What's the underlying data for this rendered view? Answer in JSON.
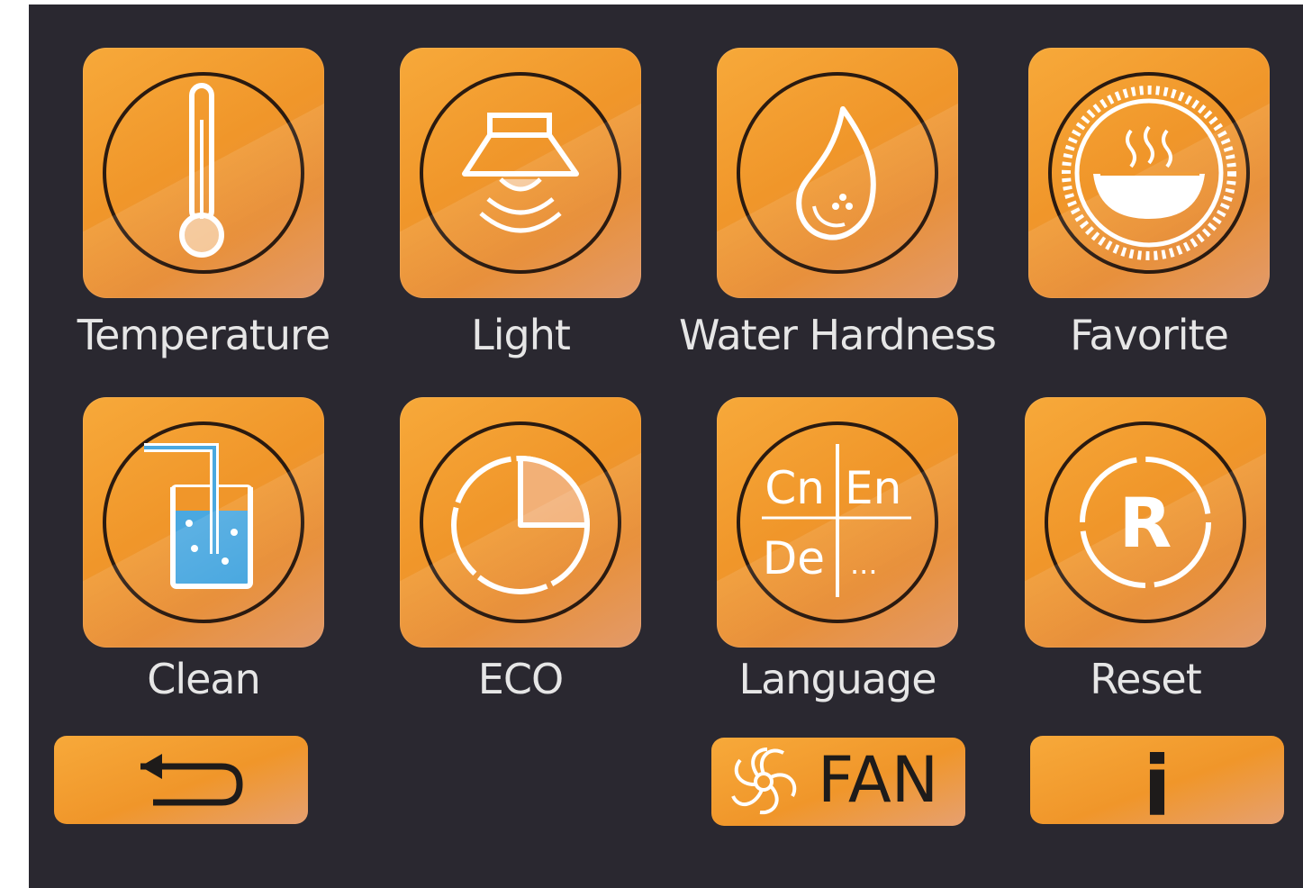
{
  "tiles": [
    {
      "label": "Temperature",
      "icon": "thermometer-icon"
    },
    {
      "label": "Light",
      "icon": "hood-light-icon"
    },
    {
      "label": "Water Hardness",
      "icon": "water-drop-icon"
    },
    {
      "label": "Favorite",
      "icon": "favorite-dish-icon"
    },
    {
      "label": "Clean",
      "icon": "clean-beaker-icon"
    },
    {
      "label": "ECO",
      "icon": "eco-timer-icon"
    },
    {
      "label": "Language",
      "icon": "language-icon"
    },
    {
      "label": "Reset",
      "icon": "reset-icon"
    }
  ],
  "language_icon": {
    "cn": "Cn",
    "en": "En",
    "de": "De",
    "more": "..."
  },
  "reset_icon": {
    "letter": "R"
  },
  "bottom": {
    "back_icon": "back-arrow-icon",
    "fan_label": "FAN",
    "fan_icon": "fan-icon",
    "info_label": "i"
  },
  "colors": {
    "background": "#2a2830",
    "tile": "#f0962a",
    "label": "#e6e6e6",
    "icon_stroke": "#ffffff",
    "ring": "#2a1a10",
    "water": "#4aa8e0"
  }
}
